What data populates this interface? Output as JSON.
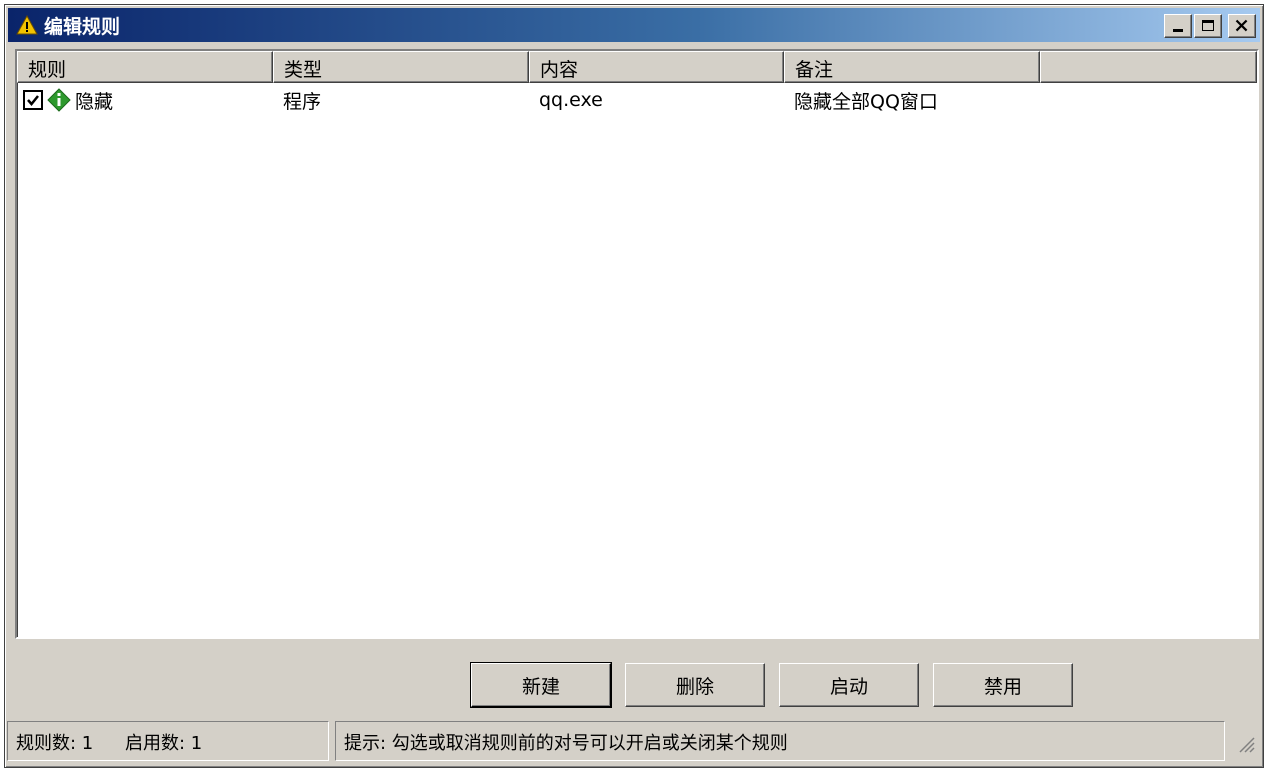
{
  "window": {
    "title": "编辑规则"
  },
  "columns": [
    "规则",
    "类型",
    "内容",
    "备注",
    ""
  ],
  "rows": [
    {
      "checked": true,
      "rule": "隐藏",
      "type": "程序",
      "content": "qq.exe",
      "note": "隐藏全部QQ窗口"
    }
  ],
  "buttons": {
    "new": "新建",
    "delete": "删除",
    "enable": "启动",
    "disable": "禁用"
  },
  "status": {
    "rule_count": "规则数: 1",
    "enabled_count": "启用数: 1",
    "hint": "提示: 勾选或取消规则前的对号可以开启或关闭某个规则"
  },
  "icons": {
    "title": "warning-triangle-icon",
    "row": "info-diamond-icon",
    "accent": "#0a246a",
    "row_icon_color": "#2e9a2e"
  }
}
